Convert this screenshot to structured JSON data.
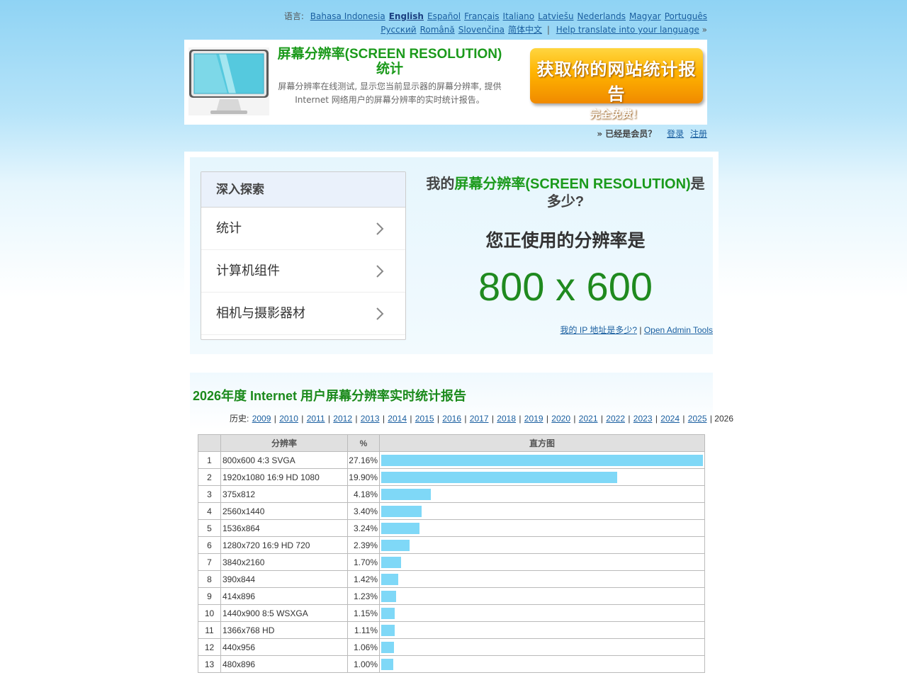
{
  "lang": {
    "label": "语言:",
    "row1": [
      "Bahasa Indonesia",
      "English",
      "Español",
      "Français",
      "Italiano",
      "Latviešu",
      "Nederlands",
      "Magyar",
      "Português"
    ],
    "row2": [
      "Русский",
      "Română",
      "Slovenčina",
      "简体中文"
    ],
    "active": "English",
    "help": "Help translate into your language",
    "help_suffix": "»"
  },
  "header": {
    "title": "屏幕分辨率(SCREEN RESOLUTION)统计",
    "description": "屏幕分辨率在线测试, 显示您当前显示器的屏幕分辨率, 提供 Internet 网络用户的屏幕分辨率的实时统计报告。",
    "promo_line1": "获取你的网站统计报告",
    "promo_line2": "完全免费！"
  },
  "member": {
    "question": "» 已经是会员？",
    "login": "登录",
    "register": "注册"
  },
  "explore": {
    "title": "深入探索",
    "items": [
      "统计",
      "计算机组件",
      "相机与摄影器材"
    ]
  },
  "myres": {
    "q_prefix": "我的",
    "q_green": "屏幕分辨率(SCREEN RESOLUTION)",
    "q_suffix": "是多少?",
    "using": "您正使用的分辨率是",
    "value": "800 x 600",
    "ip_link": "我的 IP 地址是多少?",
    "sep": "|",
    "admin_link": "Open Admin Tools"
  },
  "stats": {
    "title": "2026年度 Internet 用户屏幕分辨率实时统计报告",
    "history_label": "历史:",
    "years": [
      "2009",
      "2010",
      "2011",
      "2012",
      "2013",
      "2014",
      "2015",
      "2016",
      "2017",
      "2018",
      "2019",
      "2020",
      "2021",
      "2022",
      "2023",
      "2024",
      "2025"
    ],
    "current_year": "2026",
    "columns": [
      "",
      "分辨率",
      "%",
      "直方图"
    ],
    "rows": [
      {
        "rank": "1",
        "name": "800x600 4:3 SVGA",
        "pct": "27.16%",
        "value": 27.16
      },
      {
        "rank": "2",
        "name": "1920x1080 16:9 HD 1080",
        "pct": "19.90%",
        "value": 19.9
      },
      {
        "rank": "3",
        "name": "375x812",
        "pct": "4.18%",
        "value": 4.18
      },
      {
        "rank": "4",
        "name": "2560x1440",
        "pct": "3.40%",
        "value": 3.4
      },
      {
        "rank": "5",
        "name": "1536x864",
        "pct": "3.24%",
        "value": 3.24
      },
      {
        "rank": "6",
        "name": "1280x720 16:9 HD 720",
        "pct": "2.39%",
        "value": 2.39
      },
      {
        "rank": "7",
        "name": "3840x2160",
        "pct": "1.70%",
        "value": 1.7
      },
      {
        "rank": "8",
        "name": "390x844",
        "pct": "1.42%",
        "value": 1.42
      },
      {
        "rank": "9",
        "name": "414x896",
        "pct": "1.23%",
        "value": 1.23
      },
      {
        "rank": "10",
        "name": "1440x900 8:5 WSXGA",
        "pct": "1.15%",
        "value": 1.15
      },
      {
        "rank": "11",
        "name": "1366x768 HD",
        "pct": "1.11%",
        "value": 1.11
      },
      {
        "rank": "12",
        "name": "440x956",
        "pct": "1.06%",
        "value": 1.06
      },
      {
        "rank": "13",
        "name": "480x896",
        "pct": "1.00%",
        "value": 1.0
      }
    ]
  },
  "colors": {
    "accent_green": "#1b9a1b",
    "link": "#1a5fa0",
    "bar": "#7fd8f7"
  }
}
